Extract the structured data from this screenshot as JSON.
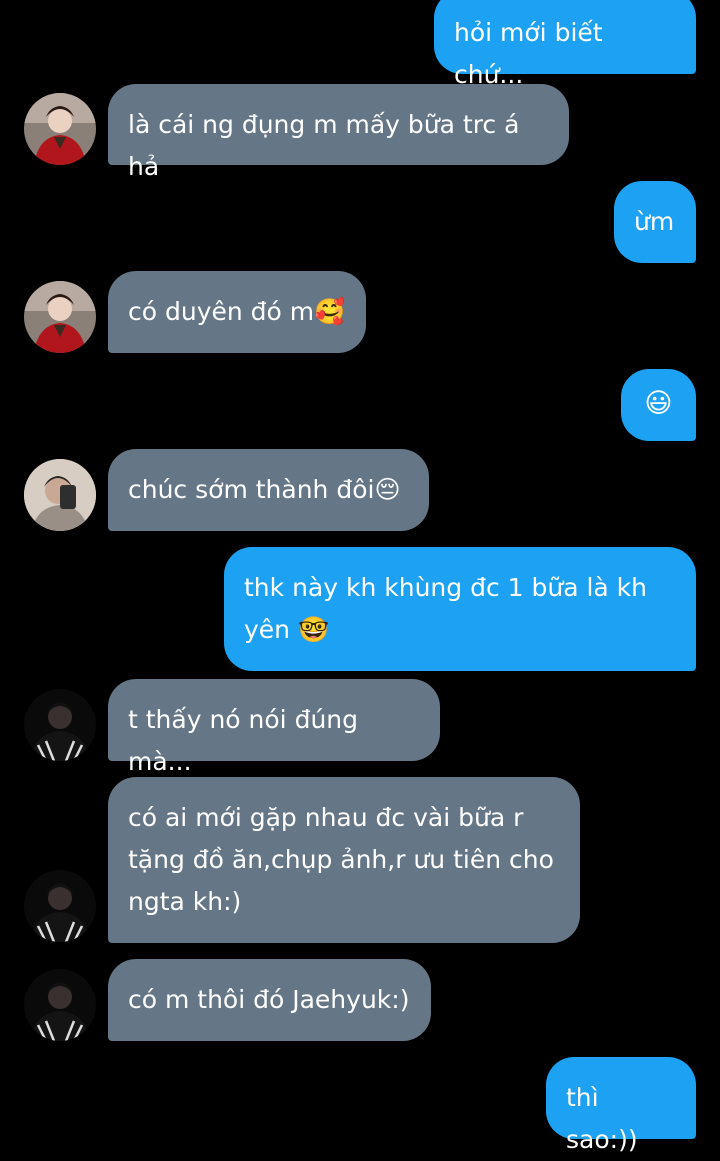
{
  "conversation": {
    "messages": [
      {
        "sender": "me",
        "text": "hỏi mới biết chứ..."
      },
      {
        "sender": "other",
        "avatar": "avatar-red-jacket",
        "text": "là cái ng đụng m mấy bữa trc á hả"
      },
      {
        "sender": "me",
        "text": "ừm"
      },
      {
        "sender": "other",
        "avatar": "avatar-red-jacket",
        "text": "có duyên đó m🥰"
      },
      {
        "sender": "me",
        "text": "😃"
      },
      {
        "sender": "other",
        "avatar": "avatar-mirror-selfie",
        "text": "chúc sớm thành đôi😔"
      },
      {
        "sender": "me",
        "text": "thk này kh khùng đc 1 bữa là kh yên 🤓"
      },
      {
        "sender": "other",
        "avatar": "avatar-dark-hood",
        "text": "t thấy nó nói đúng mà..."
      },
      {
        "sender": "other",
        "avatar": "avatar-dark-hood",
        "text": "có ai mới gặp nhau đc vài bữa r tặng đồ ăn,chụp ảnh,r ưu tiên cho ngta kh:)"
      },
      {
        "sender": "other",
        "avatar": "avatar-dark-hood",
        "text": "có m thôi đó Jaehyuk:)"
      },
      {
        "sender": "me",
        "text": "thì sao:))"
      }
    ]
  },
  "colors": {
    "background": "#000000",
    "outgoing_bubble": "#1da1f2",
    "incoming_bubble": "#657786",
    "text": "#ffffff"
  }
}
